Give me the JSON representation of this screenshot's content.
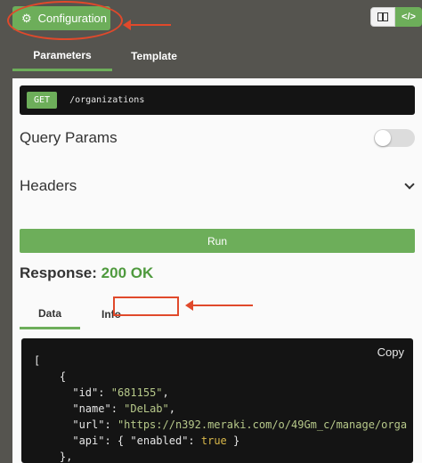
{
  "header": {
    "config_label": "Configuration",
    "config_icon": "gear-icon",
    "view_toggle": {
      "layout_icon": "layout-icon",
      "code_label": "</>"
    }
  },
  "tabs": [
    {
      "label": "Parameters",
      "active": true
    },
    {
      "label": "Template",
      "active": false
    }
  ],
  "request": {
    "method": "GET",
    "path": "/organizations"
  },
  "sections": {
    "query_params": "Query Params",
    "headers": "Headers"
  },
  "run_label": "Run",
  "response": {
    "label": "Response:",
    "code": "200",
    "status": "OK"
  },
  "data_tabs": [
    {
      "label": "Data",
      "active": true
    },
    {
      "label": "Info",
      "active": false
    }
  ],
  "code": {
    "copy_label": "Copy",
    "lines": {
      "open_bracket": "[",
      "open_brace": "{",
      "id_key": "\"id\"",
      "id_value": "\"681155\"",
      "name_key": "\"name\"",
      "name_value": "\"DeLab\"",
      "url_key": "\"url\"",
      "url_value": "\"https://n392.meraki.com/o/49Gm_c/manage/orga",
      "api_key": "\"api\"",
      "api_enabled_key": "\"enabled\"",
      "api_value": "true",
      "close_brace": "},"
    }
  },
  "colors": {
    "accent": "#6dae5a",
    "annotation": "#e0492b",
    "code_bg": "#141414",
    "chrome": "#55544f"
  }
}
